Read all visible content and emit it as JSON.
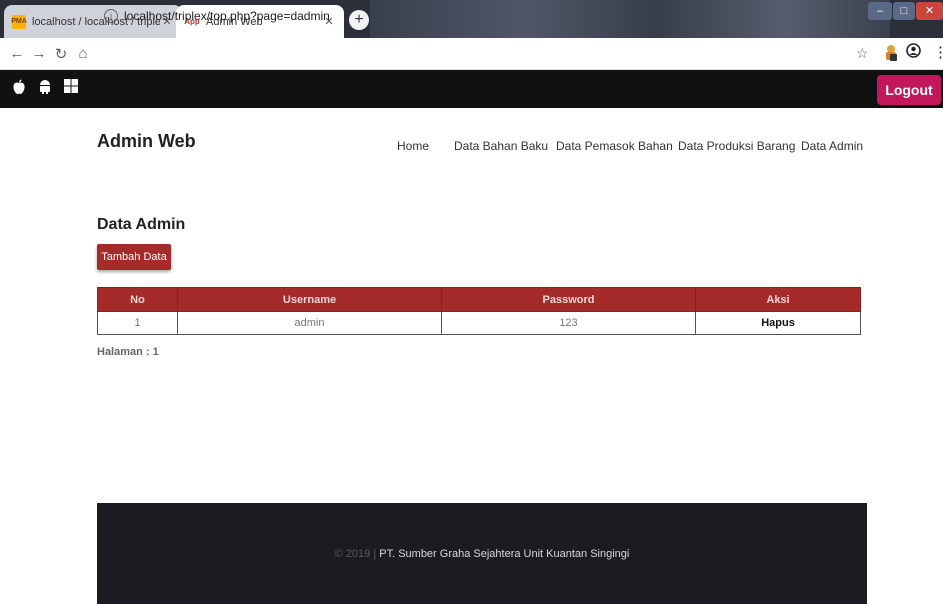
{
  "browser": {
    "tabs": [
      {
        "title": "localhost / localhost / triplex / pr",
        "favicon": "phpmyadmin-icon",
        "favicon_text": "PMA"
      },
      {
        "title": "Admin Web",
        "favicon": "app-icon",
        "favicon_text": "App"
      }
    ],
    "address": "localhost/triplex/top.php?page=dadmin"
  },
  "site": {
    "logout_label": "Logout",
    "brand": "Admin Web",
    "nav": [
      "Home",
      "Data Bahan Baku",
      "Data Pemasok Bahan",
      "Data Produksi Barang",
      "Data Admin"
    ]
  },
  "content": {
    "heading": "Data Admin",
    "add_button": "Tambah Data",
    "table": {
      "headers": [
        "No",
        "Username",
        "Password",
        "Aksi"
      ],
      "rows": [
        {
          "no": "1",
          "username": "admin",
          "password": "123",
          "action": "Hapus"
        }
      ]
    },
    "pager": "Halaman : 1"
  },
  "footer": {
    "year": "© 2019 |",
    "org": "PT. Sumber Graha Sejahtera Unit Kuantan Singingi"
  },
  "colors": {
    "accent": "#a52a2a",
    "logout": "#c2185b",
    "topbar": "#111111",
    "footer": "#1d1b22"
  }
}
